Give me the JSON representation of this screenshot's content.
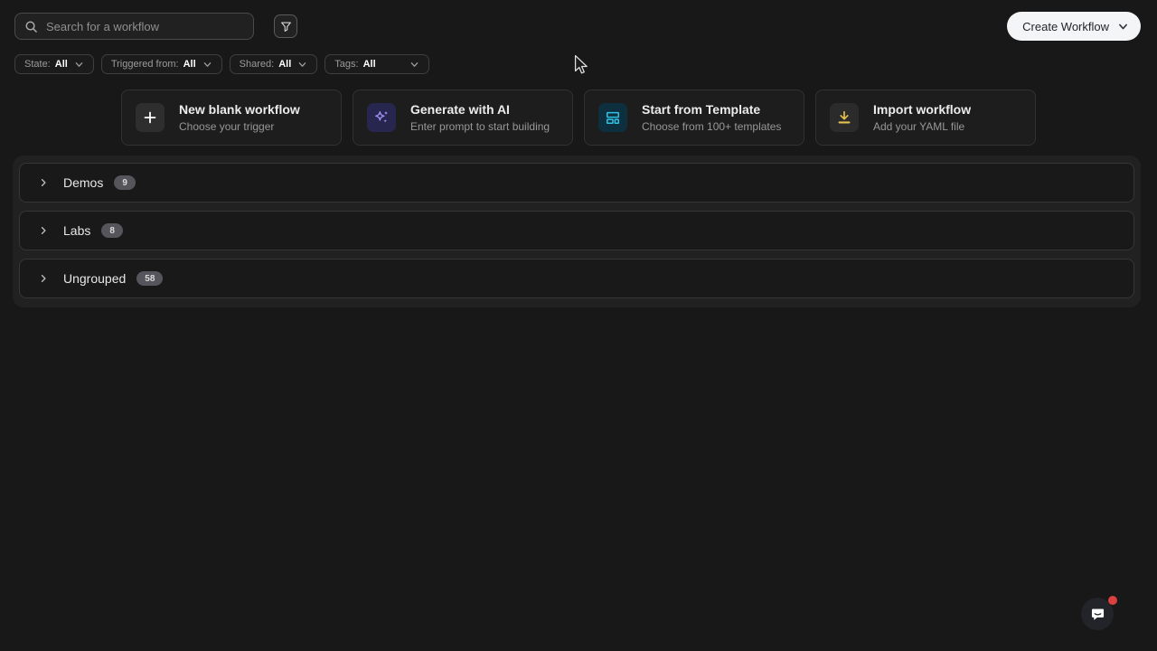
{
  "header": {
    "search": {
      "placeholder": "Search for a workflow",
      "icon": "search-icon"
    },
    "filter_button": {
      "icon": "funnel-icon"
    },
    "create_workflow": {
      "label": "Create Workflow",
      "icon": "chevron-down-icon"
    }
  },
  "filters": [
    {
      "label": "State:",
      "value": "All",
      "icon": "chevron-down-icon"
    },
    {
      "label": "Triggered from:",
      "value": "All",
      "icon": "chevron-down-icon"
    },
    {
      "label": "Shared:",
      "value": "All",
      "icon": "chevron-down-icon"
    },
    {
      "label": "Tags:",
      "value": "All",
      "icon": "chevron-down-icon"
    }
  ],
  "action_cards": [
    {
      "title": "New blank workflow",
      "subtitle": "Choose your trigger",
      "icon": "plus-icon",
      "icon_color": "#ffffff",
      "tile_color": "#2e2e2e"
    },
    {
      "title": "Generate with AI",
      "subtitle": "Enter prompt to start building",
      "icon": "sparkles-icon",
      "icon_color": "#9d8bf0",
      "tile_color": "#26264f"
    },
    {
      "title": "Start from Template",
      "subtitle": "Choose from 100+ templates",
      "icon": "template-icon",
      "icon_color": "#2ec3e6",
      "tile_color": "#0d2f3e"
    },
    {
      "title": "Import workflow",
      "subtitle": "Add your YAML file",
      "icon": "download-icon",
      "icon_color": "#e6c14d",
      "tile_color": "#2b2b2b"
    }
  ],
  "groups": [
    {
      "name": "Demos",
      "count": "9",
      "icon": "chevron-right-icon"
    },
    {
      "name": "Labs",
      "count": "8",
      "icon": "chevron-right-icon"
    },
    {
      "name": "Ungrouped",
      "count": "58",
      "icon": "chevron-right-icon"
    }
  ],
  "intercom": {
    "icon": "chat-bubble-icon",
    "notification": true
  },
  "colors": {
    "page_background": "#181818",
    "card_background": "#1d1d1d",
    "groups_container": "#212121",
    "create_button_background": "#f3f5f7",
    "create_button_text": "#22262b",
    "ai_accent": "#9d8bf0",
    "template_accent": "#2ec3e6",
    "import_accent": "#e6c14d",
    "badge_background": "#55555b",
    "notification_dot": "#d9403f"
  }
}
